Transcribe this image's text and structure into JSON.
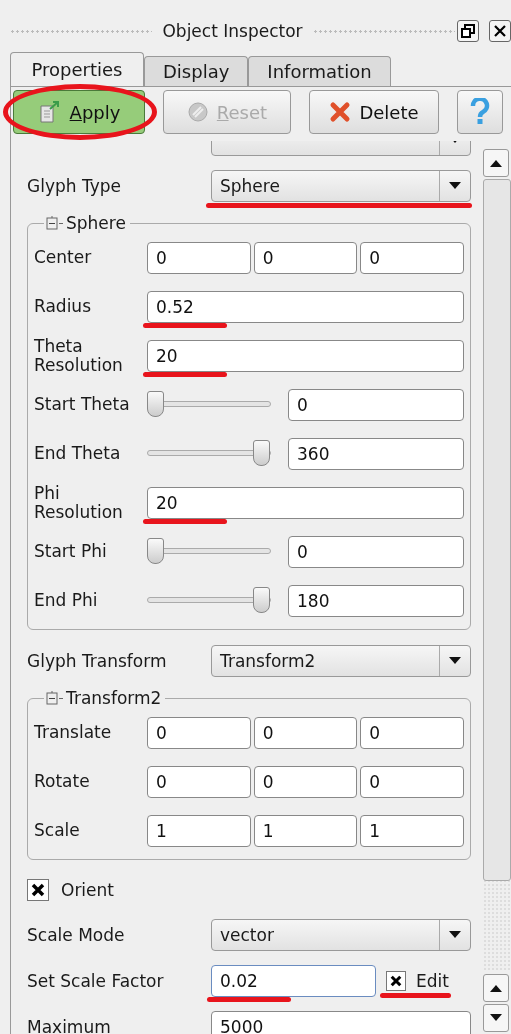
{
  "window": {
    "title": "Object Inspector"
  },
  "tabs": [
    {
      "label": "Properties",
      "selected": true
    },
    {
      "label": "Display",
      "selected": false
    },
    {
      "label": "Information",
      "selected": false
    }
  ],
  "buttons": [
    {
      "kind": "apply",
      "label": "Apply",
      "mnemonic": true,
      "disabled": false,
      "circled": true
    },
    {
      "kind": "reset",
      "label": "Reset",
      "mnemonic": true,
      "disabled": true,
      "circled": false
    },
    {
      "kind": "delete",
      "label": "Delete",
      "mnemonic": false,
      "disabled": false,
      "circled": false
    },
    {
      "kind": "help",
      "circled": false
    }
  ],
  "properties": [
    {
      "kind": "combo"
    },
    {
      "kind": "combo",
      "label": "Glyph Type",
      "value": "Sphere",
      "underlined": true
    },
    {
      "kind": "group",
      "title": "Sphere",
      "expanded": true,
      "rows": [
        {
          "kind": "triple",
          "label": "Center",
          "values": [
            "0",
            "0",
            "0"
          ]
        },
        {
          "kind": "field",
          "label": "Radius",
          "value": "0.52",
          "underlined": true
        },
        {
          "kind": "field",
          "label": "Theta Resolution",
          "value": "20",
          "underlined": true
        },
        {
          "kind": "slider",
          "label": "Start Theta",
          "level": 0,
          "value": "0"
        },
        {
          "kind": "slider",
          "label": "End Theta",
          "level": 1,
          "value": "360"
        },
        {
          "kind": "field",
          "label": "Phi Resolution",
          "value": "20",
          "underlined": true
        },
        {
          "kind": "slider",
          "label": "Start Phi",
          "level": 0,
          "value": "0"
        },
        {
          "kind": "slider",
          "label": "End Phi",
          "level": 1,
          "value": "180"
        }
      ]
    },
    {
      "kind": "combo",
      "label": "Glyph Transform",
      "value": "Transform2"
    },
    {
      "kind": "group",
      "title": "Transform2",
      "expanded": true,
      "rows": [
        {
          "kind": "triple",
          "label": "Translate",
          "values": [
            "0",
            "0",
            "0"
          ]
        },
        {
          "kind": "triple",
          "label": "Rotate",
          "values": [
            "0",
            "0",
            "0"
          ]
        },
        {
          "kind": "triple",
          "label": "Scale",
          "values": [
            "1",
            "1",
            "1"
          ]
        }
      ]
    },
    {
      "kind": "check",
      "label": "Orient",
      "checked": true
    },
    {
      "kind": "combo",
      "label": "Scale Mode",
      "value": "vector"
    },
    {
      "kind": "scale_factor",
      "label": "Set Scale Factor",
      "value": "0.02",
      "underlined": true,
      "edit": {
        "label": "Edit",
        "checked": true,
        "underlined": true
      }
    },
    {
      "kind": "field",
      "label": "Maximum",
      "value": "5000"
    }
  ]
}
